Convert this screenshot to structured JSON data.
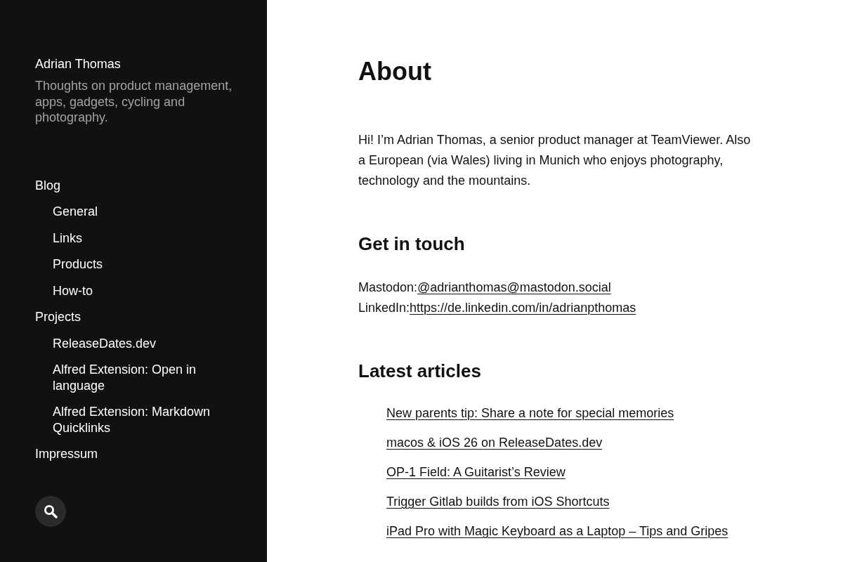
{
  "sidebar": {
    "site_title": "Adrian Thomas",
    "tagline": "Thoughts on product management, apps, gadgets, cycling and photography.",
    "nav": [
      {
        "label": "Blog",
        "children": [
          {
            "label": "General"
          },
          {
            "label": "Links"
          },
          {
            "label": "Products"
          },
          {
            "label": "How-to"
          }
        ]
      },
      {
        "label": "Projects",
        "children": [
          {
            "label": "ReleaseDates.dev"
          },
          {
            "label": "Alfred Extension: Open in language"
          },
          {
            "label": "Alfred Extension: Markdown Quicklinks"
          }
        ]
      },
      {
        "label": "Impressum"
      }
    ]
  },
  "main": {
    "title": "About",
    "sections": [
      {
        "kind": "paragraph",
        "text": "Hi! I’m Adrian Thomas, a senior product manager at TeamViewer. Also a European (via Wales) living in Munich who enjoys photography, technology and the mountains."
      },
      {
        "kind": "contacts",
        "heading": "Get in touch",
        "items": [
          {
            "label": "Mastodon:",
            "link": "@adrianthomas@mastodon.social"
          },
          {
            "label": "LinkedIn:",
            "link": "https://de.linkedin.com/in/adrianpthomas"
          }
        ]
      },
      {
        "kind": "articles",
        "heading": "Latest articles",
        "items": [
          "New parents tip: Share a note for special memories",
          "macos & iOS 26 on ReleaseDates.dev",
          "OP-1 Field: A Guitarist’s Review",
          "Trigger Gitlab builds from iOS Shortcuts",
          "iPad Pro with Magic Keyboard as a Laptop – Tips and Gripes"
        ]
      }
    ]
  }
}
